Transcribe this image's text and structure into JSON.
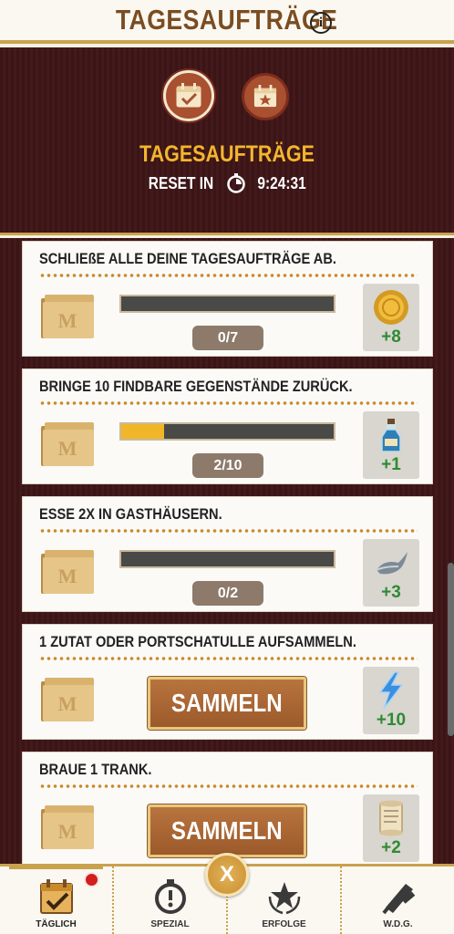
{
  "topbar": {
    "title": "TAGESAUFTRÄGE",
    "info_icon": "info-icon",
    "info_glyph": "i"
  },
  "header": {
    "title": "TAGESAUFTRÄGE",
    "reset_label": "RESET IN",
    "timer": "9:24:31",
    "tabs": [
      {
        "icon": "calendar-check-icon",
        "active": true
      },
      {
        "icon": "calendar-star-icon",
        "active": false
      }
    ]
  },
  "quests": [
    {
      "title": "SCHLIEßE ALLE DEINE TAGESAUFTRÄGE AB.",
      "progress_text": "0/7",
      "progress": 0.0,
      "reward_icon": "gold-coin-icon",
      "reward_amount": "+8"
    },
    {
      "title": "BRINGE 10 FINDBARE GEGENSTÄNDE ZURÜCK.",
      "progress_text": "2/10",
      "progress": 0.2,
      "reward_icon": "potion-bottle-icon",
      "reward_amount": "+1"
    },
    {
      "title": "ESSE 2X IN GASTHÄUSERN.",
      "progress_text": "0/2",
      "progress": 0.0,
      "reward_icon": "fish-icon",
      "reward_amount": "+3"
    },
    {
      "title": "1 ZUTAT ODER PORTSCHATULLE AUFSAMMELN.",
      "button_label": "SAMMELN",
      "reward_icon": "lightning-icon",
      "reward_amount": "+10"
    },
    {
      "title": "BRAUE 1 TRANK.",
      "button_label": "SAMMELN",
      "reward_icon": "scroll-icon",
      "reward_amount": "+2"
    }
  ],
  "nav": {
    "items": [
      {
        "label": "TÄGLICH",
        "icon": "calendar-check-icon",
        "active": true,
        "badge": true
      },
      {
        "label": "SPEZIAL",
        "icon": "stopwatch-icon",
        "active": false
      },
      {
        "label": "ERFOLGE",
        "icon": "star-wreath-icon",
        "active": false
      },
      {
        "label": "W.D.G.",
        "icon": "scroll-wand-icon",
        "active": false
      }
    ],
    "close_label": "X"
  },
  "colors": {
    "accent_gold": "#c9a24e",
    "header_title": "#f3b62d",
    "reward_green": "#2f8a34",
    "bg_maroon": "#3b1416"
  }
}
